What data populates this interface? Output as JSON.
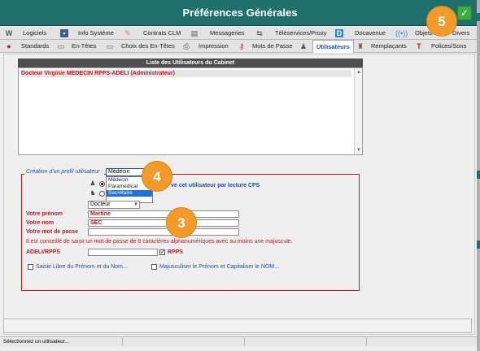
{
  "window": {
    "title": "Préférences Générales"
  },
  "tabs_row1": [
    {
      "label": "Logiciels",
      "icon": "W"
    },
    {
      "label": "Info Système",
      "icon": "info-system-icon"
    },
    {
      "label": "Contrats CLM",
      "icon": "pen-icon"
    },
    {
      "label": "Messageries",
      "icon": "mail-icon"
    },
    {
      "label": "Téléservices/Proxy",
      "icon": "network-icon"
    },
    {
      "label": "Docavenue",
      "icon": "D"
    },
    {
      "label": "Objets",
      "icon": "wifi-icon"
    },
    {
      "label": "Divers",
      "icon": ""
    }
  ],
  "tabs_row2": [
    {
      "label": "Standards",
      "icon": "red-dot-icon"
    },
    {
      "label": "En-Têtes",
      "icon": "doc-icon"
    },
    {
      "label": "Choix des En-Têtes",
      "icon": "doc-icon"
    },
    {
      "label": "Impression",
      "icon": "printer-icon"
    },
    {
      "label": "Mots de Passe",
      "icon": "key-icon"
    },
    {
      "label": "Utilisateurs",
      "icon": "user-icon",
      "active": true
    },
    {
      "label": "Remplaçants",
      "icon": "users-icon"
    },
    {
      "label": "Polices/Sons",
      "icon": "font-icon"
    }
  ],
  "users_list": {
    "title": "Liste des Utilisateurs du Cabinet",
    "items": [
      "Docteur Virginie MEDECIN RPPS-ADELI (Administrateur)"
    ]
  },
  "profile": {
    "group_label": "Création d'un profil utilisateur :",
    "selected": "Médecin",
    "options": [
      "Médecin",
      "Paramédical",
      "Secrétaire"
    ],
    "highlighted": "Secrétaire",
    "cps_text": "ve cet utilisateur par lecture CPS",
    "title_combo": "Docteur"
  },
  "form": {
    "first_name_label": "Votre prénom",
    "first_name_value": "Martine",
    "last_name_label": "Votre nom",
    "last_name_value": "SEC",
    "password_label": "Votre mot de passe",
    "password_value": "",
    "hint": "Il est conseillé de saisir un mot de passe de 8 caractères alphanumériques avec au moins une majuscule.",
    "adeli_label": "ADELI/RPPS",
    "adeli_value": "",
    "rpps_label": "RPPS",
    "rpps_checked": true,
    "free_entry_label": "Saisie Libre du Prénom et du Nom...",
    "capitalize_label": "Majusculiser le Prénom et Capitaliser le NOM..."
  },
  "status_bar": {
    "text": "Sélectionnez un utilisateur..."
  },
  "badges": [
    "5",
    "4",
    "3"
  ],
  "colors": {
    "title_bg": "#1f6f6b",
    "accent_red": "#c4161c",
    "accent_blue": "#1f4fa0",
    "badge": "#f29b2a"
  }
}
